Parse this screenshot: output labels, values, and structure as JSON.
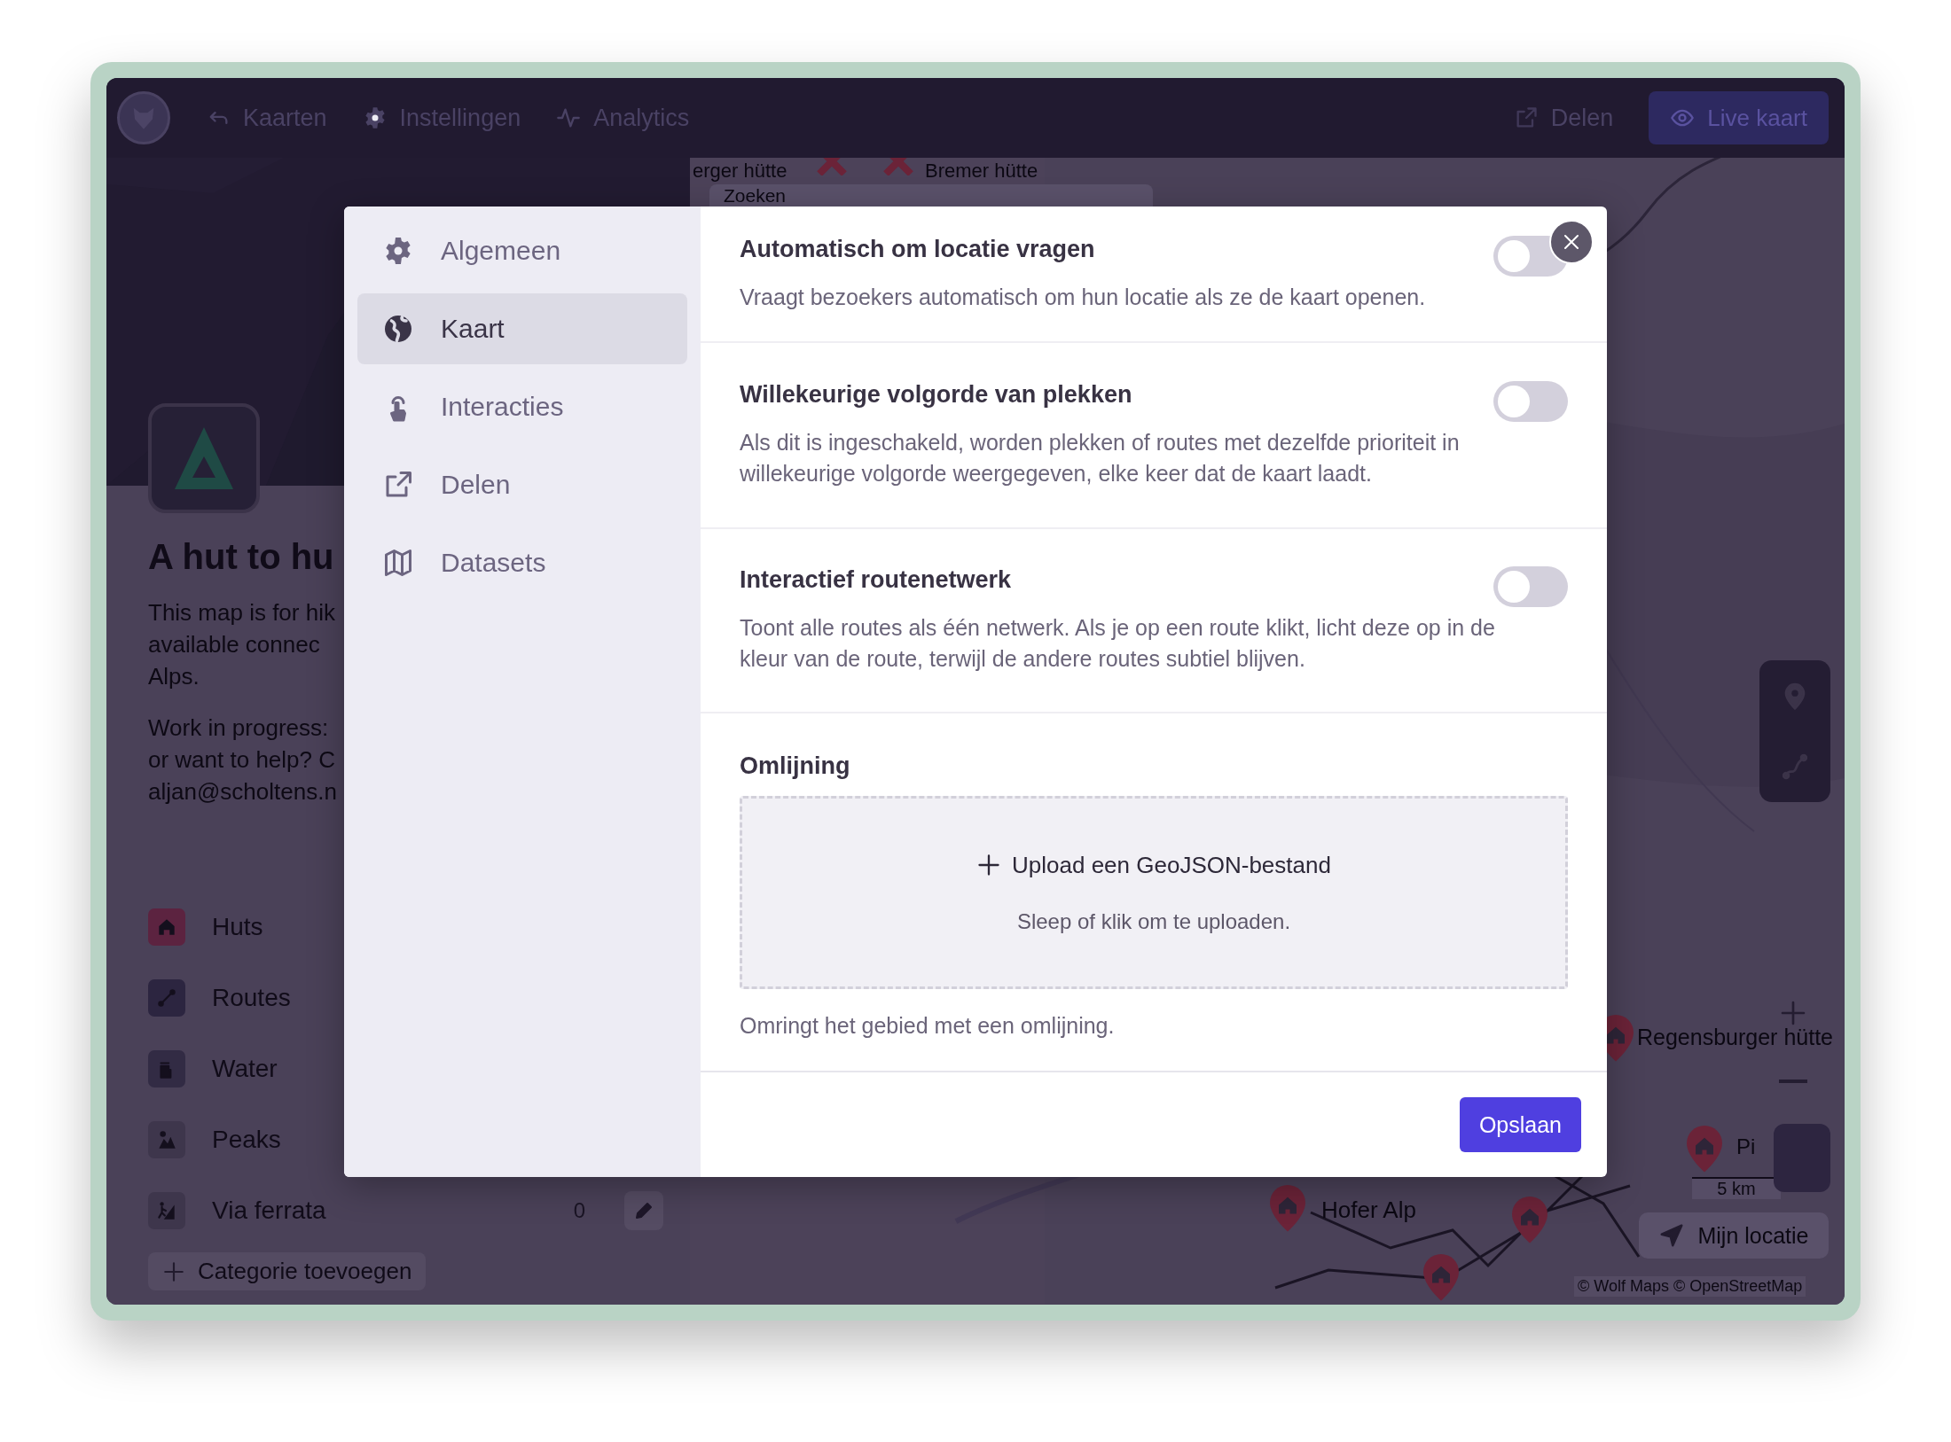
{
  "topbar": {
    "nav": [
      {
        "label": "Kaarten"
      },
      {
        "label": "Instellingen"
      },
      {
        "label": "Analytics"
      }
    ],
    "share": "Delen",
    "live": "Live kaart"
  },
  "sidebar": {
    "title": "A hut to hu",
    "description": [
      "This map is for hik",
      "available connec",
      "Alps."
    ],
    "note": [
      "Work in progress:",
      "or want to help? C",
      "aljan@scholtens.n"
    ],
    "categories": [
      {
        "name": "Huts",
        "color": "#5c2340"
      },
      {
        "name": "Routes",
        "color": "#2c2540"
      },
      {
        "name": "Water",
        "color": "#322b44"
      },
      {
        "name": "Peaks",
        "color": "#3e364c"
      },
      {
        "name": "Via ferrata",
        "color": "#3e364c",
        "count": "0"
      }
    ],
    "add_category": "Categorie toevoegen"
  },
  "map": {
    "search": {
      "placeholder": "Zoeken"
    },
    "markers": [
      {
        "label": "erger hütte"
      },
      {
        "label": "Bremer hütte"
      },
      {
        "label": "Regensburger hütte"
      },
      {
        "label": "Pi"
      },
      {
        "label": "Hofer Alp"
      }
    ],
    "scale": "5 km",
    "locate": "Mijn locatie",
    "attribution": "© Wolf Maps © OpenStreetMap"
  },
  "settings": {
    "nav": [
      {
        "label": "Algemeen",
        "selected": false
      },
      {
        "label": "Kaart",
        "selected": true
      },
      {
        "label": "Interacties",
        "selected": false
      },
      {
        "label": "Delen",
        "selected": false
      },
      {
        "label": "Datasets",
        "selected": false
      }
    ],
    "options": [
      {
        "kind": "toggle",
        "title": "Automatisch om locatie vragen",
        "description": "Vraagt bezoekers automatisch om hun locatie als ze de kaart openen.",
        "on": false
      },
      {
        "kind": "toggle",
        "title": "Willekeurige volgorde van plekken",
        "description": "Als dit is ingeschakeld, worden plekken of routes met dezelfde prioriteit in willekeurige volgorde weergegeven, elke keer dat de kaart laadt.",
        "on": false
      },
      {
        "kind": "toggle",
        "title": "Interactief routenetwerk",
        "description": "Toont alle routes als één netwerk. Als je op een route klikt, licht deze op in de kleur van de route, terwijl de andere routes subtiel blijven.",
        "on": false
      },
      {
        "kind": "upload",
        "title": "Omlijning",
        "upload_label": "Upload een GeoJSON-bestand",
        "upload_hint": "Sleep of klik om te uploaden.",
        "description": "Omringt het gebied met een omlijning."
      }
    ],
    "save": "Opslaan"
  }
}
